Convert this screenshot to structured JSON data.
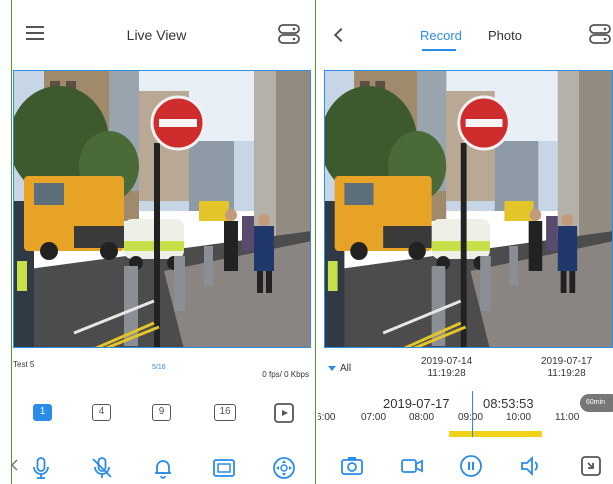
{
  "colors": {
    "accent": "#2a8ce8",
    "frame": "#4e9a2b",
    "icon": "#555555",
    "recording": "#f0d21a"
  },
  "live_view": {
    "title": "Live View",
    "camera_name": "Test 5",
    "page_indicator": "5/16",
    "stream_rate": "0 fps/ 0 Kbps",
    "split_options": [
      "1",
      "4",
      "9",
      "16"
    ],
    "active_split": "1",
    "icons": {
      "menu": "menu-icon",
      "device": "device-list-icon",
      "more": "play-square-icon",
      "controls": [
        "microphone-icon",
        "mute-microphone-icon",
        "bell-icon",
        "screen-icon",
        "ptz-icon"
      ]
    }
  },
  "playback": {
    "tabs": [
      "Record",
      "Photo"
    ],
    "active_tab": "Record",
    "filter_label": "All",
    "range_start": {
      "date": "2019-07-14",
      "time": "11:19:28"
    },
    "range_end": {
      "date": "2019-07-17",
      "time": "11:19:28"
    },
    "current_date": "2019-07-17",
    "current_time": "08:53:53",
    "zoom_label": "60min",
    "timeline_ticks": [
      "6:00",
      "07:00",
      "08:00",
      "09:00",
      "10:00",
      "11:00"
    ],
    "recording_segment": {
      "start": "08:30",
      "end": "10:20"
    },
    "icons": {
      "back": "back-icon",
      "device": "device-list-icon",
      "controls": [
        "snapshot-icon",
        "record-video-icon",
        "pause-icon",
        "volume-icon",
        "fullscreen-icon"
      ]
    }
  }
}
